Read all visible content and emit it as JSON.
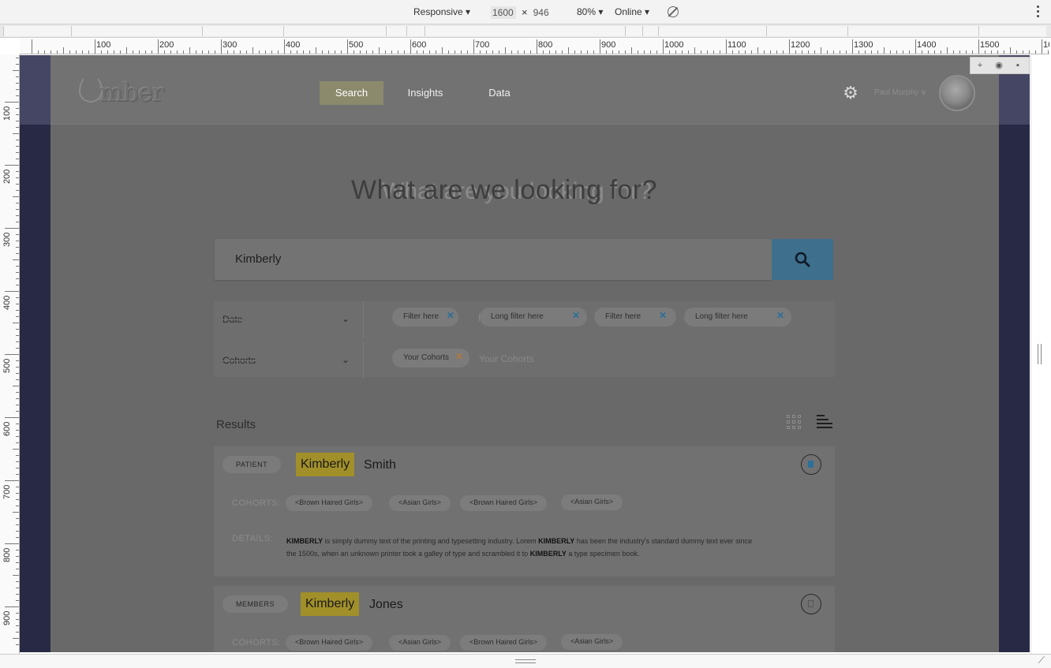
{
  "devtools": {
    "device_mode": "Responsive ▾",
    "width": "1600",
    "height": "946",
    "times": "×",
    "zoom": "80% ▾",
    "network": "Online ▾"
  },
  "ruler": {
    "h_labels": [
      "100",
      "200",
      "300",
      "400",
      "500",
      "600",
      "700",
      "800",
      "900",
      "1000",
      "1100",
      "1200",
      "1300",
      "1400",
      "1500",
      "1600"
    ],
    "v_labels": [
      "100",
      "200",
      "300",
      "400",
      "500",
      "600",
      "700",
      "800",
      "900"
    ]
  },
  "header": {
    "logo_text": "mber",
    "nav": [
      {
        "label": "Search"
      },
      {
        "label": "Insights"
      },
      {
        "label": "Data"
      }
    ],
    "user_name": "Paul Murphy ∨"
  },
  "hero": {
    "title": "What are we looking for?",
    "ghost": "What are you looking for?"
  },
  "search": {
    "value": "Kimberly"
  },
  "filters": {
    "date": {
      "label": "Date",
      "chips": [
        "Filter here",
        "Long filter here",
        "Filter here",
        "Long filter here"
      ],
      "ghost": "Filt"
    },
    "cohorts": {
      "label": "Cohorts",
      "chips": [
        "Your Cohorts"
      ],
      "ghost": "Your Cohorts"
    }
  },
  "results": {
    "label": "Results",
    "cards": [
      {
        "type": "PATIENT",
        "first": "Kimberly",
        "last": "Smith",
        "cohorts_label": "COHORTS:",
        "cohorts": [
          "<Brown Haired Girls>",
          "<Asian Girls>",
          "<Brown Haired Girls>",
          "<Asian Girls>"
        ],
        "details_label": "DETAILS:",
        "details_line1_a": "KIMBERLY",
        "details_line1_b": " is simply dummy text of the printing and typesetting industry. Lorem ",
        "details_line1_c": "KIMBERLY",
        "details_line1_d": " has been the industry's standard dummy text ever since",
        "details_line2_a": "the 1500s, when an unknown printer took a galley of type and scrambled it to ",
        "details_line2_b": "KIMBERLY",
        "details_line2_c": " a type specimen book."
      },
      {
        "type": "MEMBERS",
        "first": "Kimberly",
        "last": "Jones",
        "cohorts_label": "COHORTS:",
        "cohorts": [
          "<Brown Haired Girls>",
          "<Asian Girls>",
          "<Brown Haired Girls>",
          "<Asian Girls>"
        ]
      }
    ]
  },
  "colors": {
    "nav_active": "#8c8a6c",
    "search_button": "#3e6f8d",
    "name_highlight": "#a18f2a",
    "chip_remove": "#2c6f99",
    "sidebar": "#282a45"
  },
  "icons": [
    "search-icon",
    "gear-icon",
    "chevron-down-icon",
    "close-icon",
    "grid-view-icon",
    "list-view-icon",
    "bookmark-icon",
    "rotate-icon",
    "more-vert-icon"
  ]
}
